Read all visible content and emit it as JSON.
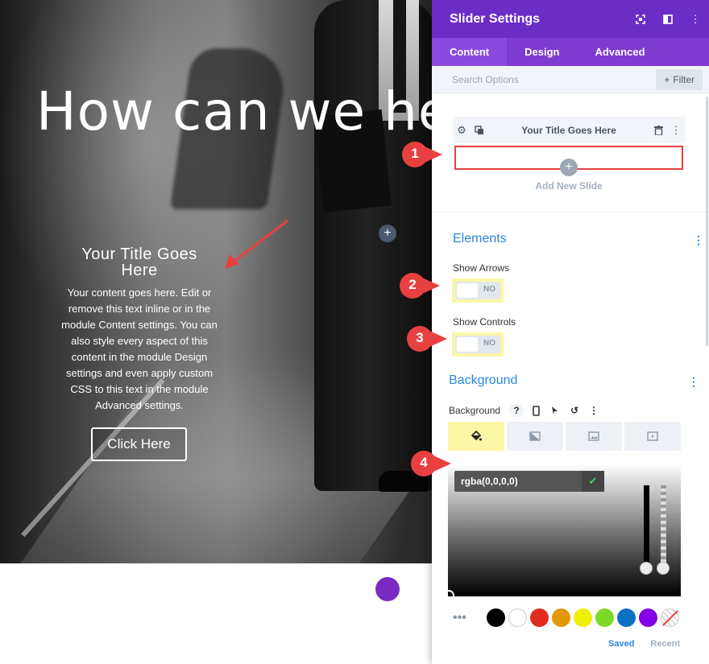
{
  "hero": {
    "heading": "How can we help?",
    "slide_title": "Your Title Goes Here",
    "slide_body": "Your content goes here. Edit or remove this text inline or in the module Content settings. You can also style every aspect of this content in the module Design settings and even apply custom CSS to this text in the module Advanced settings.",
    "button_label": "Click Here",
    "add_icon": "plus-icon"
  },
  "panel": {
    "title": "Slider Settings",
    "header_icons": [
      "expand-icon",
      "columns-icon",
      "more-vertical-icon"
    ],
    "tabs": [
      {
        "label": "Content",
        "active": true
      },
      {
        "label": "Design",
        "active": false
      },
      {
        "label": "Advanced",
        "active": false
      }
    ],
    "search_placeholder": "Search Options",
    "filter_label": "Filter",
    "slide_item_label": "Your Title Goes Here",
    "add_slide_label": "Add New Slide",
    "elements": {
      "title": "Elements",
      "show_arrows_label": "Show Arrows",
      "show_arrows_value": "NO",
      "show_controls_label": "Show Controls",
      "show_controls_value": "NO"
    },
    "background": {
      "title": "Background",
      "field_label": "Background",
      "color_value": "rgba(0,0,0,0)",
      "tabs": [
        "color-fill-icon",
        "gradient-icon",
        "image-icon",
        "video-icon"
      ],
      "swatches": [
        "#000000",
        "#ffffff",
        "#e02b20",
        "#e09900",
        "#edf000",
        "#7cda24",
        "#0c71c3",
        "#8300e9",
        "none"
      ],
      "saved_label": "Saved",
      "recent_label": "Recent"
    }
  },
  "callouts": [
    "1",
    "2",
    "3",
    "4"
  ],
  "colors": {
    "accent_purple": "#6c2dc7",
    "tab_purple": "#7e3bd0",
    "link_blue": "#2b87da",
    "callout_red": "#e84040",
    "highlight_yellow": "#fbf7a6"
  }
}
